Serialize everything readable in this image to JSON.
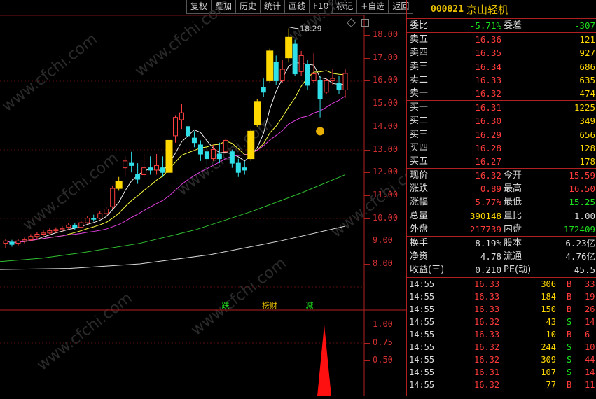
{
  "toolbar": [
    "复权",
    "叠加",
    "历史",
    "统计",
    "画线",
    "F10",
    "标记",
    "+自选",
    "返回"
  ],
  "chart": {
    "price_axis": [
      "18.00",
      "17.00",
      "16.00",
      "15.00",
      "14.00",
      "13.00",
      "12.00",
      "11.00",
      "10.00",
      "9.00",
      "8.00"
    ],
    "indicator_axis": [
      "1.00",
      "0.75",
      "0.50"
    ],
    "high_marker": "18.29",
    "signals": [
      {
        "text": "跌",
        "color": "#1de01d"
      },
      {
        "text": "榜财",
        "color": "#e8c000"
      },
      {
        "text": "减",
        "color": "#1de01d"
      }
    ],
    "watermark": "www.cfchi.com"
  },
  "stock": {
    "code": "000821",
    "name": "京山轻机"
  },
  "weibi": {
    "label": "委比",
    "value": "-5.71%",
    "label2": "委差",
    "value2": "-307"
  },
  "asks": [
    {
      "label": "卖五",
      "price": "16.36",
      "vol": "121"
    },
    {
      "label": "卖四",
      "price": "16.35",
      "vol": "927"
    },
    {
      "label": "卖三",
      "price": "16.34",
      "vol": "686"
    },
    {
      "label": "卖二",
      "price": "16.33",
      "vol": "635"
    },
    {
      "label": "卖一",
      "price": "16.32",
      "vol": "474"
    }
  ],
  "bids": [
    {
      "label": "买一",
      "price": "16.31",
      "vol": "1225"
    },
    {
      "label": "买二",
      "price": "16.30",
      "vol": "349"
    },
    {
      "label": "买三",
      "price": "16.29",
      "vol": "656"
    },
    {
      "label": "买四",
      "price": "16.28",
      "vol": "128"
    },
    {
      "label": "买五",
      "price": "16.27",
      "vol": "178"
    }
  ],
  "stats": [
    {
      "l1": "现价",
      "v1": "16.32",
      "c1": "red",
      "l2": "今开",
      "v2": "15.59",
      "c2": "red"
    },
    {
      "l1": "涨跌",
      "v1": "0.89",
      "c1": "red",
      "l2": "最高",
      "v2": "16.50",
      "c2": "red"
    },
    {
      "l1": "涨幅",
      "v1": "5.77%",
      "c1": "red",
      "l2": "最低",
      "v2": "15.25",
      "c2": "green"
    },
    {
      "l1": "总量",
      "v1": "390148",
      "c1": "yellow",
      "l2": "量比",
      "v2": "1.00",
      "c2": "white"
    },
    {
      "l1": "外盘",
      "v1": "217739",
      "c1": "red",
      "l2": "内盘",
      "v2": "172409",
      "c2": "green"
    }
  ],
  "fund": [
    {
      "l1": "换手",
      "v1": "8.19%",
      "l2": "股本",
      "v2": "6.23亿"
    },
    {
      "l1": "净资",
      "v1": "4.78",
      "l2": "流通",
      "v2": "4.76亿"
    },
    {
      "l1": "收益(三)",
      "v1": "0.210",
      "l2": "PE(动)",
      "v2": "45.5"
    }
  ],
  "ticks": [
    {
      "time": "14:55",
      "price": "16.33",
      "vol": "306",
      "side": "B",
      "n": "33"
    },
    {
      "time": "14:55",
      "price": "16.33",
      "vol": "184",
      "side": "B",
      "n": "19"
    },
    {
      "time": "14:55",
      "price": "16.33",
      "vol": "150",
      "side": "B",
      "n": "26"
    },
    {
      "time": "14:55",
      "price": "16.32",
      "vol": "43",
      "side": "S",
      "n": "14"
    },
    {
      "time": "14:55",
      "price": "16.33",
      "vol": "10",
      "side": "B",
      "n": "6"
    },
    {
      "time": "14:55",
      "price": "16.32",
      "vol": "244",
      "side": "S",
      "n": "10"
    },
    {
      "time": "14:55",
      "price": "16.32",
      "vol": "309",
      "side": "S",
      "n": "44"
    },
    {
      "time": "14:55",
      "price": "16.31",
      "vol": "107",
      "side": "S",
      "n": "14"
    },
    {
      "time": "14:55",
      "price": "16.32",
      "vol": "77",
      "side": "B",
      "n": "11"
    }
  ]
}
